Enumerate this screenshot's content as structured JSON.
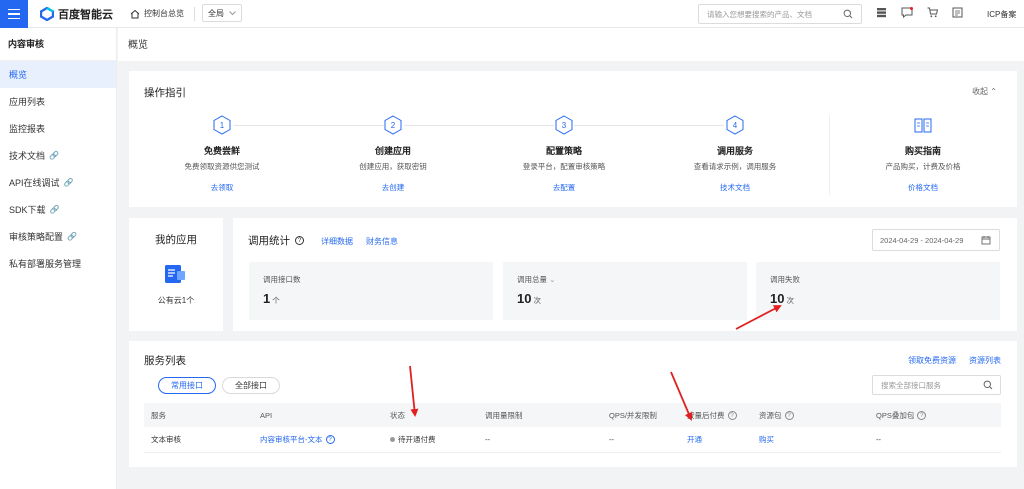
{
  "topbar": {
    "logo_text": "百度智能云",
    "home_label": "控制台总览",
    "region": "全局",
    "search_placeholder": "请输入您想要搜索的产品、文档",
    "icp_label": "ICP备案"
  },
  "sidebar": {
    "title": "内容审核",
    "items": [
      {
        "label": "概览",
        "active": true,
        "external": false
      },
      {
        "label": "应用列表",
        "active": false,
        "external": false
      },
      {
        "label": "监控报表",
        "active": false,
        "external": false
      },
      {
        "label": "技术文档",
        "active": false,
        "external": true
      },
      {
        "label": "API在线调试",
        "active": false,
        "external": true
      },
      {
        "label": "SDK下载",
        "active": false,
        "external": true
      },
      {
        "label": "审核策略配置",
        "active": false,
        "external": true
      },
      {
        "label": "私有部署服务管理",
        "active": false,
        "external": false
      }
    ]
  },
  "page": {
    "title": "概览"
  },
  "guide": {
    "title": "操作指引",
    "collapse_label": "收起",
    "steps": [
      {
        "num": "1",
        "title": "免费尝鲜",
        "desc": "免费领取资源供您测试",
        "link": "去领取"
      },
      {
        "num": "2",
        "title": "创建应用",
        "desc": "创建应用，获取密钥",
        "link": "去创建"
      },
      {
        "num": "3",
        "title": "配置策略",
        "desc": "登录平台，配置审核策略",
        "link": "去配置"
      },
      {
        "num": "4",
        "title": "调用服务",
        "desc": "查看请求示例，调用服务",
        "link": "技术文档"
      }
    ],
    "buy": {
      "title": "购买指南",
      "desc": "产品购买，计费及价格",
      "link": "价格文档"
    }
  },
  "myapp": {
    "title": "我的应用",
    "label": "公有云1个"
  },
  "stats": {
    "title": "调用统计",
    "link_detail": "详细数据",
    "link_finance": "财务信息",
    "date_range": "2024-04-29 - 2024-04-29",
    "boxes": [
      {
        "label": "调用接口数",
        "value": "1",
        "unit": "个"
      },
      {
        "label": "调用总量",
        "value": "10",
        "unit": "次"
      },
      {
        "label": "调用失败",
        "value": "10",
        "unit": "次"
      }
    ]
  },
  "services": {
    "title": "服务列表",
    "link_free": "领取免费资源",
    "link_resources": "资源列表",
    "tab_common": "常用接口",
    "tab_all": "全部接口",
    "search_placeholder": "搜索全部接口服务",
    "columns": [
      "服务",
      "API",
      "状态",
      "调用量限制",
      "QPS/并发限制",
      "按量后付费",
      "资源包",
      "QPS叠加包"
    ],
    "rows": [
      {
        "service": "文本审核",
        "api": "内容审核平台-文本",
        "status": "待开通付费",
        "limit": "--",
        "qps": "--",
        "postpaid": "开通",
        "package": "购买",
        "qps_pack": "--"
      }
    ]
  },
  "colors": {
    "accent": "#2468f2",
    "arrow": "#e02020"
  }
}
